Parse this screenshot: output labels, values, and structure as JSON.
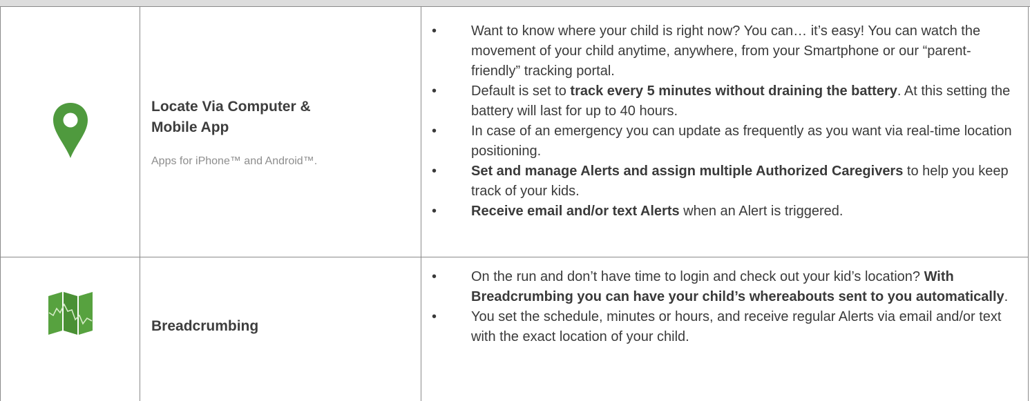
{
  "colors": {
    "icon_green": "#4f9a3e",
    "map_green": "#57a23f",
    "border": "#8a8a8a",
    "header_bg": "#dddddd"
  },
  "rows": [
    {
      "icon": "location-pin-icon",
      "title": "Locate Via Computer & Mobile App",
      "subtitle": "Apps for iPhone™ and Android™.",
      "bullets": [
        [
          {
            "text": "Want to know where your child is right now? You can… it’s easy! You can watch the movement of your child anytime, anywhere, from your Smartphone or our “parent-friendly” tracking portal.",
            "bold": false
          }
        ],
        [
          {
            "text": "Default is set to ",
            "bold": false
          },
          {
            "text": "track every 5 minutes without draining the battery",
            "bold": true
          },
          {
            "text": ".  At this setting the battery will last for up to 40 hours.",
            "bold": false
          }
        ],
        [
          {
            "text": "In case of an emergency you can update as frequently as you want via real-time location positioning.",
            "bold": false
          }
        ],
        [
          {
            "text": "Set and manage Alerts and assign multiple Authorized Caregivers",
            "bold": true
          },
          {
            "text": " to help you keep track of your kids.",
            "bold": false
          }
        ],
        [
          {
            "text": "Receive email and/or text Alerts",
            "bold": true
          },
          {
            "text": " when an Alert is triggered.",
            "bold": false
          }
        ]
      ]
    },
    {
      "icon": "folded-map-icon",
      "title": "Breadcrumbing",
      "subtitle": "",
      "bullets": [
        [
          {
            "text": "On the run and don’t have time to login and check out your kid’s location? ",
            "bold": false
          },
          {
            "text": "With Breadcrumbing you can have your child’s whereabouts sent to you automatically",
            "bold": true
          },
          {
            "text": ".",
            "bold": false
          }
        ],
        [
          {
            "text": "You set the schedule, minutes or hours, and receive regular Alerts via email and/or text with the exact location of your child.",
            "bold": false
          }
        ]
      ]
    }
  ]
}
